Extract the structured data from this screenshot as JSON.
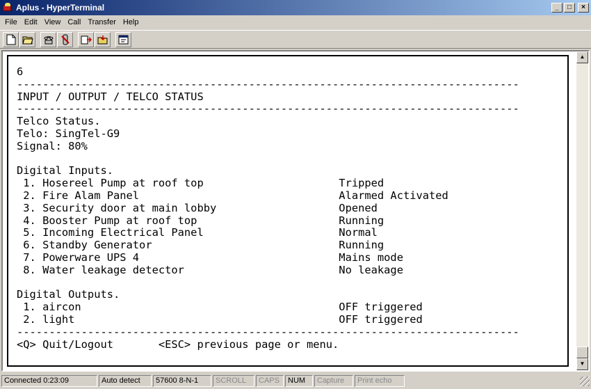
{
  "window": {
    "title": "Aplus - HyperTerminal"
  },
  "menu": [
    "File",
    "Edit",
    "View",
    "Call",
    "Transfer",
    "Help"
  ],
  "terminal_lines": [
    "6",
    "------------------------------------------------------------------------------",
    "INPUT / OUTPUT / TELCO STATUS",
    "------------------------------------------------------------------------------",
    "Telco Status.",
    "Telo: SingTel-G9",
    "Signal: 80%",
    "",
    "Digital Inputs.",
    " 1. Hosereel Pump at roof top                     Tripped",
    " 2. Fire Alam Panel                               Alarmed Activated",
    " 3. Security door at main lobby                   Opened",
    " 4. Booster Pump at roof top                      Running",
    " 5. Incoming Electrical Panel                     Normal",
    " 6. Standby Generator                             Running",
    " 7. Powerware UPS 4                               Mains mode",
    " 8. Water leakage detector                        No leakage",
    "",
    "Digital Outputs.",
    " 1. aircon                                        OFF triggered",
    " 2. light                                         OFF triggered",
    "------------------------------------------------------------------------------",
    "<Q> Quit/Logout       <ESC> previous page or menu."
  ],
  "status": {
    "connected": "Connected 0:23:09",
    "detect": "Auto detect",
    "settings": "57600 8-N-1",
    "scroll": "SCROLL",
    "caps": "CAPS",
    "num": "NUM",
    "capture": "Capture",
    "print_echo": "Print echo"
  },
  "icons": {
    "new": "new-document-icon",
    "open": "open-folder-icon",
    "call": "phone-icon",
    "disconnect": "hangup-icon",
    "send": "send-file-icon",
    "receive": "receive-file-icon",
    "properties": "properties-icon"
  }
}
